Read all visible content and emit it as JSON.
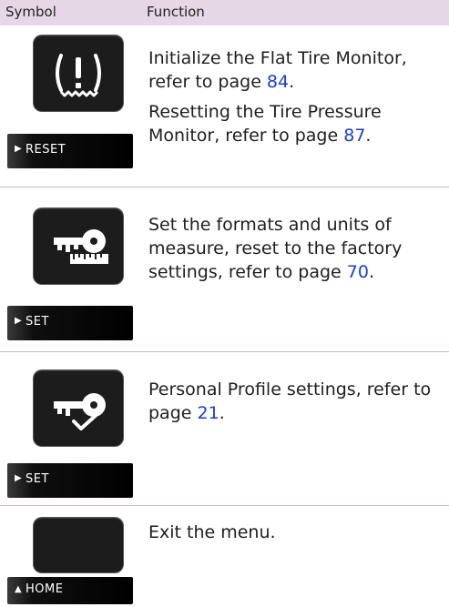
{
  "header": {
    "symbol": "Symbol",
    "function": "Function"
  },
  "rows": [
    {
      "icon": "tire-pressure-warning-icon",
      "button_label": "RESET",
      "paragraphs": [
        {
          "text": "Initialize the Flat Tire Monitor, refer to page ",
          "page": "84",
          "suffix": "."
        },
        {
          "text": "Resetting the Tire Pressure Monitor, refer to page ",
          "page": "87",
          "suffix": "."
        }
      ]
    },
    {
      "icon": "key-ruler-settings-icon",
      "button_label": "SET",
      "paragraphs": [
        {
          "text": "Set the formats and units of measure, reset to the factory settings, refer to page ",
          "page": "70",
          "suffix": "."
        }
      ]
    },
    {
      "icon": "key-check-profile-icon",
      "button_label": "SET",
      "paragraphs": [
        {
          "text": "Personal Profile settings, refer to page ",
          "page": "21",
          "suffix": "."
        }
      ]
    },
    {
      "icon": "blank-button",
      "button_label": "HOME",
      "paragraphs": [
        {
          "text": "Exit the menu.",
          "page": "",
          "suffix": ""
        }
      ]
    }
  ],
  "colors": {
    "header_bg": "#e6d7e6",
    "link": "#1a3fd0",
    "divider": "#c8bcc8"
  }
}
